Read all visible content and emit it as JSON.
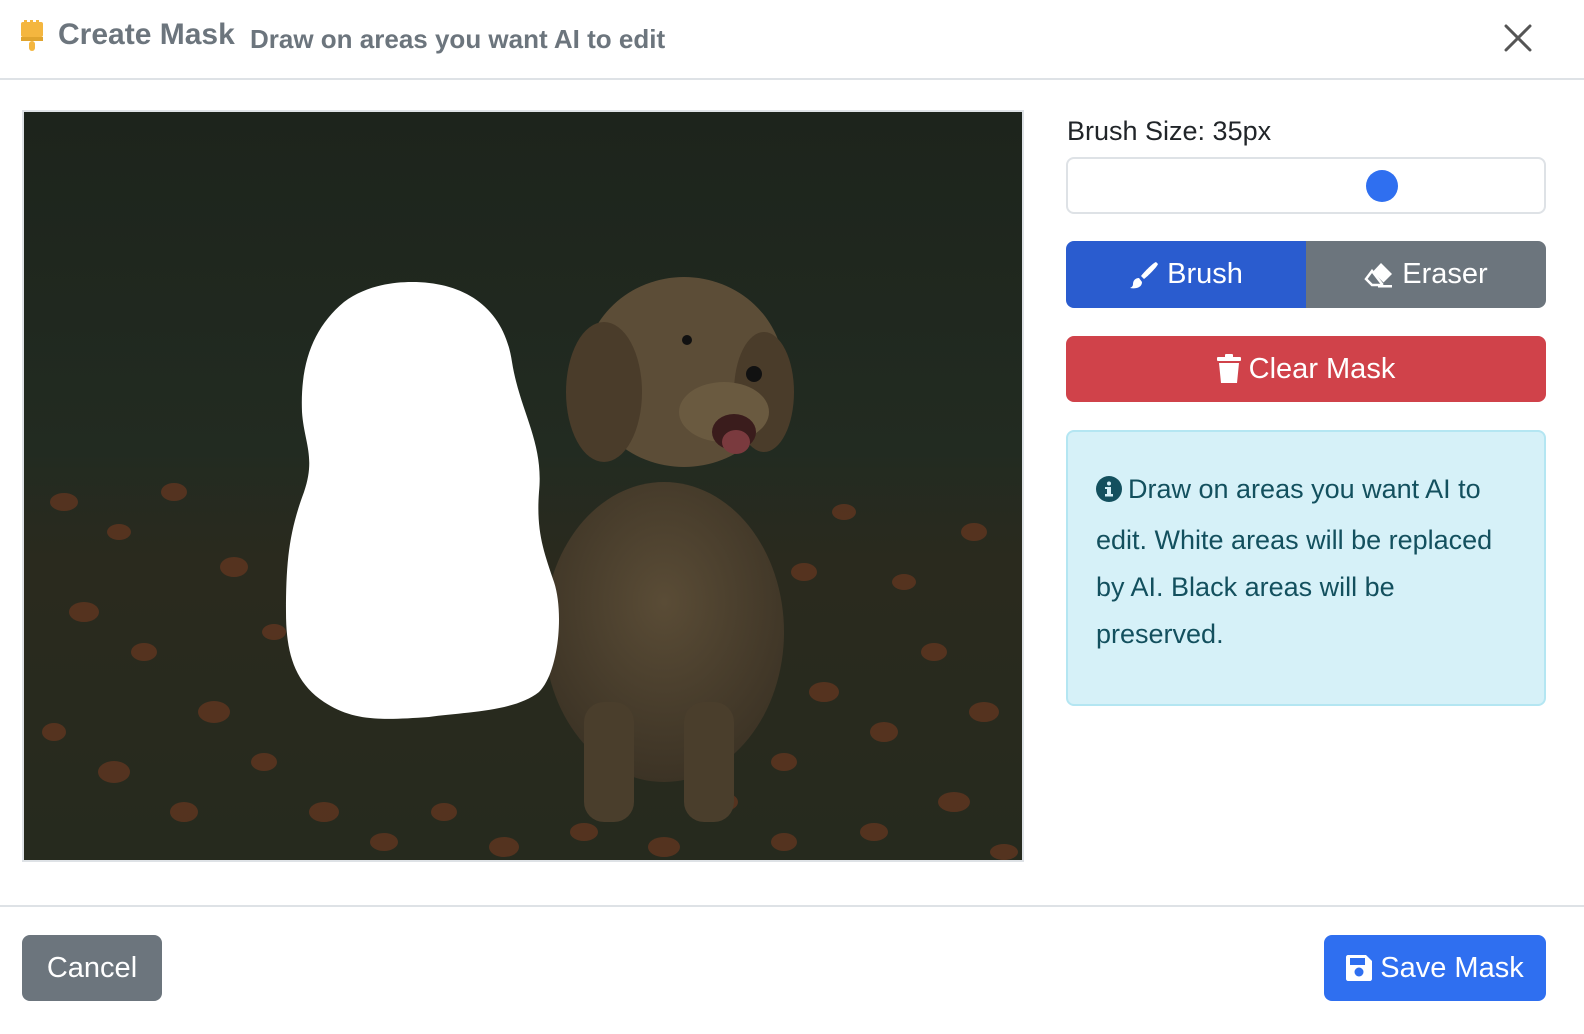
{
  "header": {
    "icon": "paint-brush-icon",
    "title": "Create Mask",
    "subtitle": "Draw on areas you want AI to edit",
    "close_icon": "close-icon"
  },
  "canvas": {
    "image_subject": "puppy-in-flower-field",
    "mask_color": "#ffffff"
  },
  "controls": {
    "brush_size_label": "Brush Size: 35px",
    "brush_size_fraction": 0.66,
    "tools": [
      {
        "label": "Brush",
        "icon": "paint-brush-icon",
        "active": true
      },
      {
        "label": "Eraser",
        "icon": "eraser-icon",
        "active": false
      }
    ],
    "clear_label": "Clear Mask",
    "clear_icon": "trash-icon",
    "info_icon": "info-circle-icon",
    "info_text": "Draw on areas you want AI to edit. White areas will be replaced by AI. Black areas will be preserved."
  },
  "footer": {
    "cancel_label": "Cancel",
    "save_label": "Save Mask",
    "save_icon": "save-icon"
  },
  "colors": {
    "primary": "#2f6ff0",
    "brush_active": "#2a5ccf",
    "secondary": "#6c757d",
    "danger": "#d0424a",
    "info_bg": "#d6f1f8",
    "info_text": "#13505e",
    "header_icon": "#f4b63f"
  }
}
